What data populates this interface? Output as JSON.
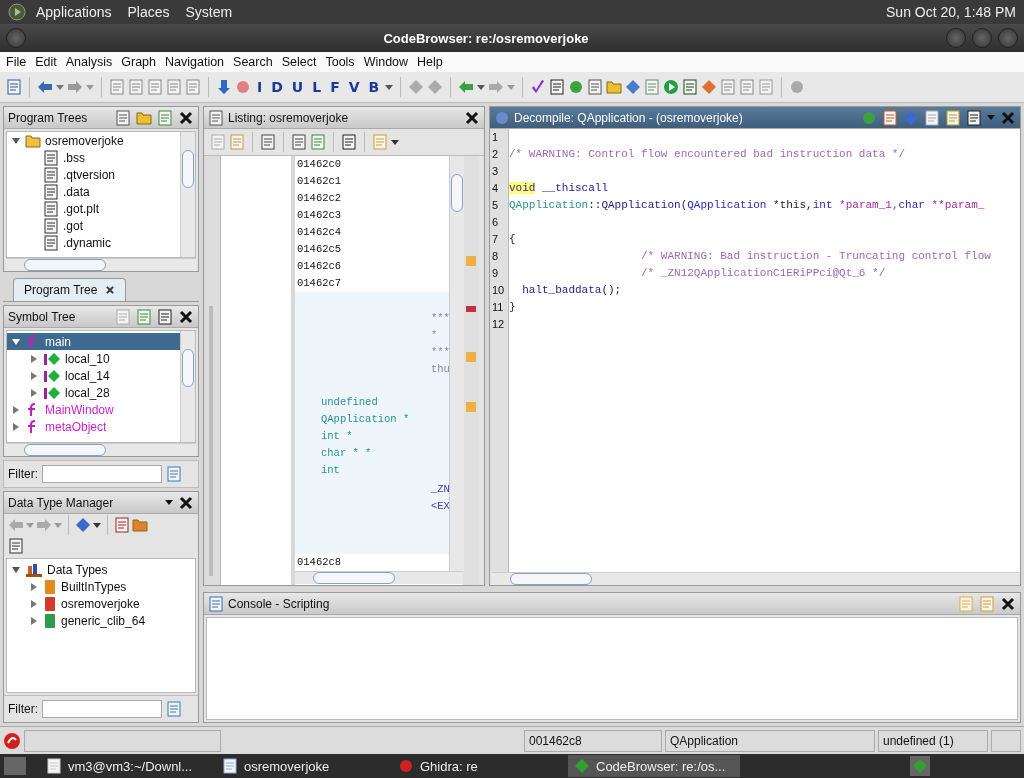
{
  "top_panel": {
    "menus": [
      "Applications",
      "Places",
      "System"
    ],
    "clock": "Sun Oct 20, 1:48 PM"
  },
  "window": {
    "title": "CodeBrowser: re:/osremoverjoke"
  },
  "menu_bar": [
    "File",
    "Edit",
    "Analysis",
    "Graph",
    "Navigation",
    "Search",
    "Select",
    "Tools",
    "Window",
    "Help"
  ],
  "toolbar": {
    "letter_buttons": [
      "I",
      "D",
      "U",
      "L",
      "F",
      "V",
      "B"
    ]
  },
  "program_trees": {
    "title": "Program Trees",
    "items": [
      {
        "label": "osremoverjoke",
        "expanded": true,
        "children": [
          {
            "label": ".bss"
          },
          {
            "label": ".qtversion"
          },
          {
            "label": ".data"
          },
          {
            "label": ".got.plt"
          },
          {
            "label": ".got"
          },
          {
            "label": ".dynamic"
          }
        ]
      }
    ],
    "tabs": [
      {
        "label": "Program Tree",
        "selected": true
      }
    ]
  },
  "symbol_tree": {
    "title": "Symbol Tree",
    "items": [
      {
        "label": "main",
        "kind": "function",
        "expanded": true,
        "selected": true,
        "children": [
          {
            "label": "local_10",
            "kind": "local",
            "expanded": false,
            "selected": false
          },
          {
            "label": "local_14",
            "kind": "local",
            "expanded": false,
            "selected": false
          },
          {
            "label": "local_28",
            "kind": "local",
            "expanded": false,
            "selected": false
          }
        ]
      },
      {
        "label": "MainWindow",
        "kind": "function",
        "expanded": false,
        "selected": false
      },
      {
        "label": "metaObject",
        "kind": "function",
        "expanded": false,
        "selected": false
      }
    ],
    "filter": {
      "label": "Filter:"
    }
  },
  "data_type_manager": {
    "title": "Data Type Manager",
    "items": [
      {
        "label": "Data Types",
        "expanded": true,
        "children": [
          {
            "label": "BuiltInTypes",
            "expanded": false,
            "color": "#e08a20"
          },
          {
            "label": "osremoverjoke",
            "expanded": false,
            "color": "#d83a2a"
          },
          {
            "label": "generic_clib_64",
            "expanded": false,
            "color": "#2e9a4a"
          }
        ]
      }
    ],
    "filter": {
      "label": "Filter:"
    }
  },
  "listing": {
    "title": "Listing:  osremoverjoke",
    "top_addresses": [
      "01462c0",
      "01462c1",
      "01462c2",
      "01462c3",
      "01462c4",
      "01462c5",
      "01462c6",
      "01462c7"
    ],
    "header_comments": [
      "***",
      "*",
      "***",
      "thu"
    ],
    "param_types": [
      "undefined",
      "QApplication *",
      "int *",
      "char * *",
      "int"
    ],
    "labels": [
      "_ZN",
      "<EX"
    ],
    "bottom_addresses": [
      "01462c8"
    ]
  },
  "decompile": {
    "title": "Decompile: QApplication -  (osremoverjoke)",
    "lines": [
      {
        "num": "1"
      },
      {
        "num": "2",
        "tokens": [
          {
            "kind": "comment",
            "text": "/* WARNING: Control flow encountered bad instruction data */"
          }
        ]
      },
      {
        "num": "3"
      },
      {
        "num": "4",
        "tokens": [
          {
            "kind": "type",
            "text": "void",
            "highlighted": true
          },
          {
            "kind": "func",
            "text": " __thiscall",
            "highlighted": false
          }
        ]
      },
      {
        "num": "5",
        "tokens": [
          {
            "kind": "namespace",
            "text": "QApplication"
          },
          {
            "kind": "plain",
            "text": "::"
          },
          {
            "kind": "func",
            "text": "QApplication("
          },
          {
            "kind": "type",
            "text": "QApplication"
          },
          {
            "kind": "plain",
            "text": " *this,"
          },
          {
            "kind": "type",
            "text": "int"
          },
          {
            "kind": "param",
            "text": " *param_1,"
          },
          {
            "kind": "type",
            "text": "char"
          },
          {
            "kind": "param",
            "text": " **param_"
          }
        ]
      },
      {
        "num": "6"
      },
      {
        "num": "7",
        "tokens": [
          {
            "kind": "plain",
            "text": "{"
          }
        ]
      },
      {
        "num": "8",
        "tokens": [
          {
            "kind": "comment",
            "text": "                    /* WARNING: Bad instruction - Truncating control flow"
          }
        ]
      },
      {
        "num": "9",
        "tokens": [
          {
            "kind": "comment",
            "text": "                    /* _ZN12QApplicationC1ERiPPci@Qt_6 */"
          }
        ]
      },
      {
        "num": "10",
        "tokens": [
          {
            "kind": "func",
            "text": "  halt_baddata"
          },
          {
            "kind": "plain",
            "text": "();"
          }
        ]
      },
      {
        "num": "11",
        "tokens": [
          {
            "kind": "plain",
            "text": "}"
          }
        ]
      },
      {
        "num": "12"
      }
    ]
  },
  "console": {
    "title": "Console - Scripting"
  },
  "status_bar": {
    "fields": [
      "001462c8",
      "QApplication",
      "undefined  (1)"
    ]
  },
  "taskbar": {
    "items": [
      {
        "label": "vm3@vm3:~/Downl...",
        "selected": false
      },
      {
        "label": "osremoverjoke",
        "selected": false
      },
      {
        "label": "Ghidra: re",
        "selected": false
      },
      {
        "label": "CodeBrowser: re:/os...",
        "selected": true
      }
    ]
  }
}
